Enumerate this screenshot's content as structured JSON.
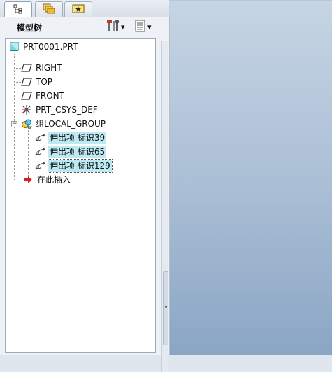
{
  "tabs": [
    {
      "name": "model-tree-tab-icon",
      "active": true
    },
    {
      "name": "folder-browser-tab-icon",
      "active": false
    },
    {
      "name": "favorites-tab-icon",
      "active": false
    }
  ],
  "panel": {
    "title": "模型树",
    "settings_dropdown": "▾",
    "show_dropdown": "▾"
  },
  "tree": {
    "root": "PRT0001.PRT",
    "items": [
      {
        "label": "RIGHT",
        "icon": "datum-plane-icon"
      },
      {
        "label": "TOP",
        "icon": "datum-plane-icon"
      },
      {
        "label": "FRONT",
        "icon": "datum-plane-icon"
      },
      {
        "label": "PRT_CSYS_DEF",
        "icon": "coordinate-system-icon"
      },
      {
        "label": "组LOCAL_GROUP",
        "icon": "group-icon"
      }
    ],
    "group_children": [
      {
        "label": "伸出项 标识39",
        "icon": "extrude-icon"
      },
      {
        "label": "伸出项 标识65",
        "icon": "extrude-icon"
      },
      {
        "label": "伸出项 标识129",
        "icon": "extrude-icon"
      }
    ],
    "insert_here": "在此插入"
  },
  "colors": {
    "selection": "#bde9f2",
    "insert_arrow": "#d3201c",
    "viewport_top": "#c6d5e4",
    "viewport_bottom": "#8aa6c5"
  }
}
